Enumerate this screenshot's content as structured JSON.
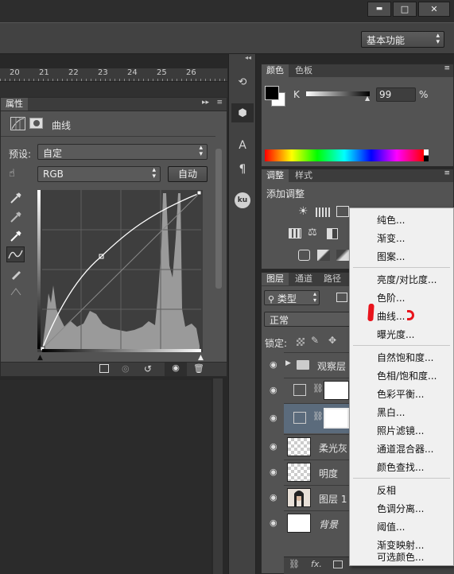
{
  "window": {
    "minimize_glyph": "▬",
    "maximize_glyph": "□",
    "close_glyph": "✕"
  },
  "workspace": {
    "label": "基本功能"
  },
  "ruler": {
    "ticks": [
      "20",
      "21",
      "22",
      "23",
      "24",
      "25",
      "26"
    ]
  },
  "properties": {
    "tab": "属性",
    "title": "曲线",
    "preset_label": "预设:",
    "preset_value": "自定",
    "channel_value": "RGB",
    "auto_button": "自动"
  },
  "color_panel": {
    "tabs": [
      "颜色",
      "色板"
    ],
    "channel_label": "K",
    "value": "99",
    "unit": "%"
  },
  "adjust_panel": {
    "tabs": [
      "调整",
      "样式"
    ],
    "title": "添加调整"
  },
  "layers_panel": {
    "tabs": [
      "图层",
      "通道",
      "路径"
    ],
    "filter_kind": "类型",
    "blend_mode": "正常",
    "lock_label": "锁定:",
    "layers": [
      {
        "name": "观察层",
        "type": "folder"
      },
      {
        "name": "",
        "type": "adjust"
      },
      {
        "name": "",
        "type": "adjust-selected"
      },
      {
        "name": "柔光灰",
        "type": "checker"
      },
      {
        "name": "明度",
        "type": "checker"
      },
      {
        "name": "图层 1",
        "type": "photo"
      },
      {
        "name": "背景",
        "type": "white"
      }
    ]
  },
  "context_menu": {
    "groups": [
      [
        "纯色...",
        "渐变...",
        "图案..."
      ],
      [
        "亮度/对比度...",
        "色阶...",
        "曲线...",
        "曝光度..."
      ],
      [
        "自然饱和度...",
        "色相/饱和度...",
        "色彩平衡...",
        "黑白...",
        "照片滤镜...",
        "通道混合器...",
        "颜色查找..."
      ],
      [
        "反相",
        "色调分离...",
        "阈值...",
        "渐变映射...",
        "可选颜色..."
      ]
    ]
  },
  "colors": {
    "highlight_mark": "#e8141c",
    "menu_bg": "#f0f0f0",
    "panel_bg": "#535353"
  }
}
